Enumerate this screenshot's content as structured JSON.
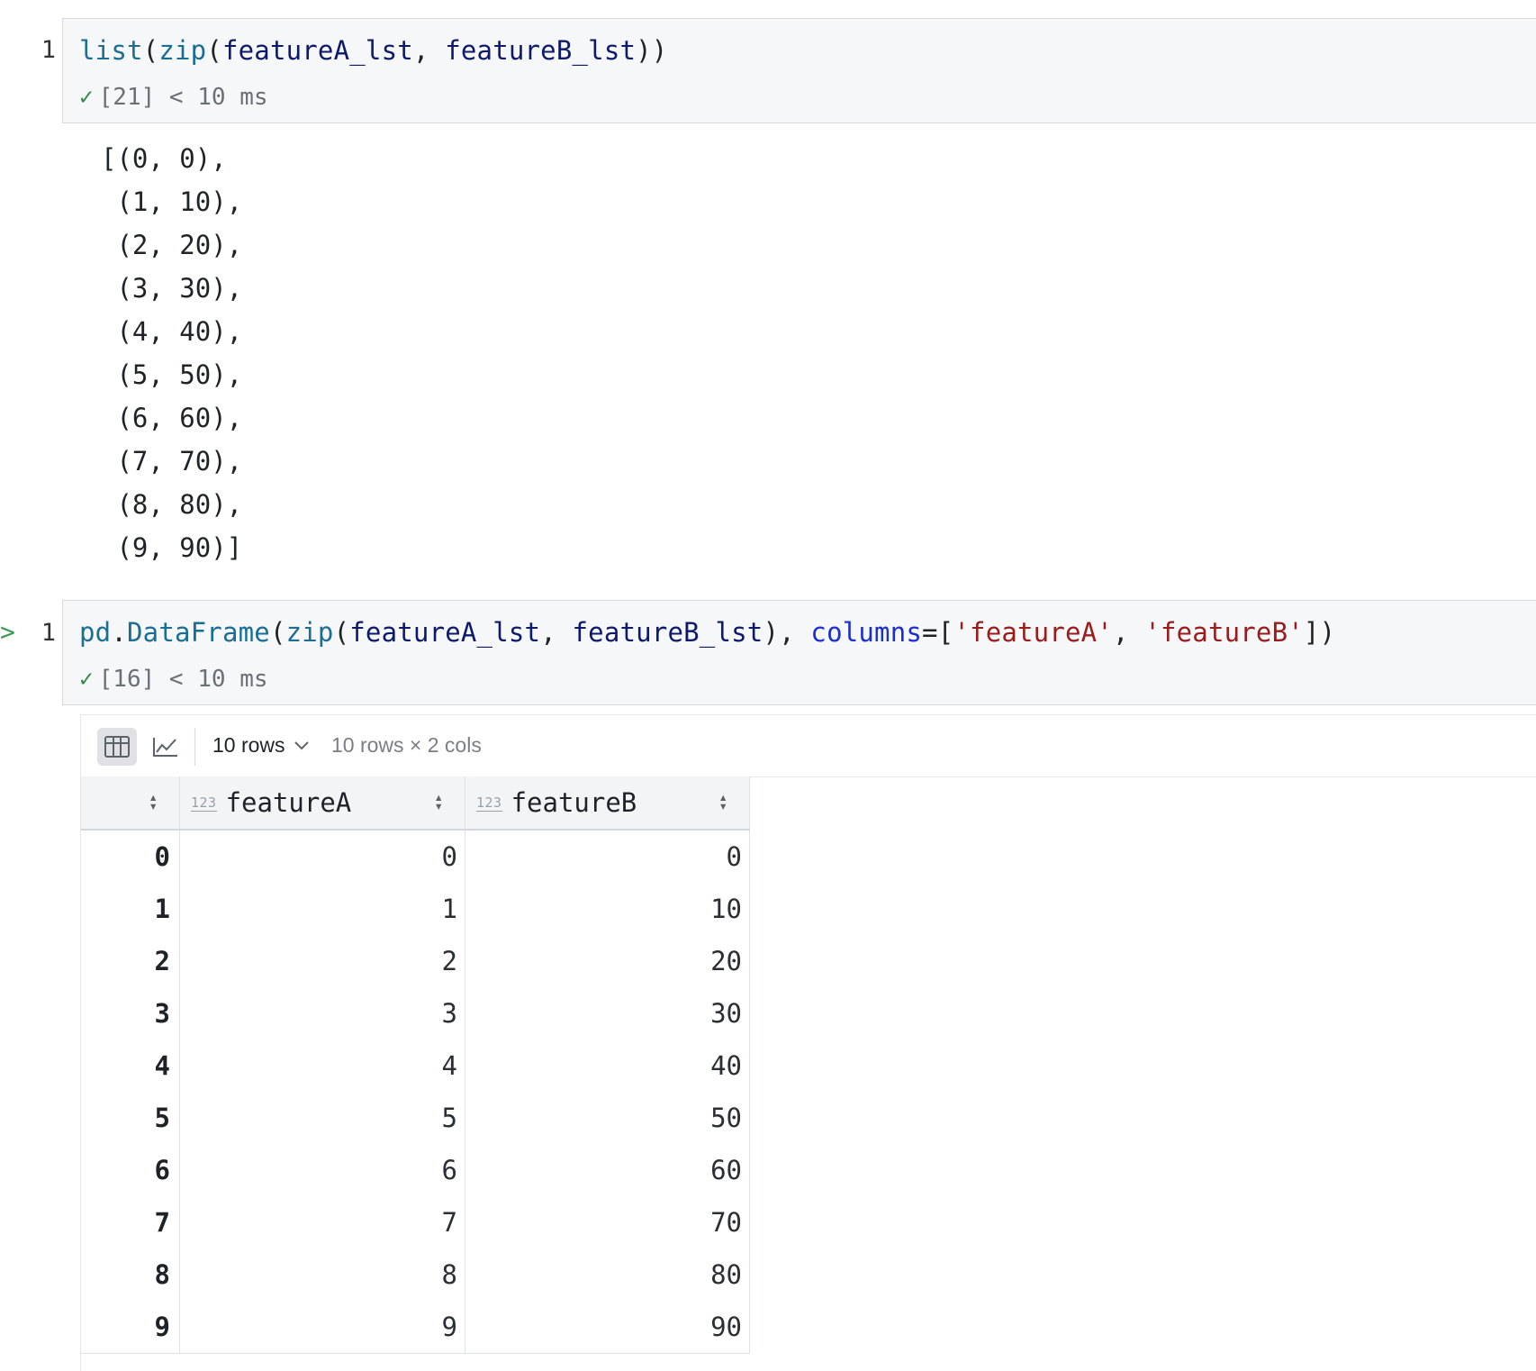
{
  "cell1": {
    "line_number": "1",
    "code_tokens": [
      {
        "t": "list",
        "c": "fn"
      },
      {
        "t": "(",
        "c": "punc"
      },
      {
        "t": "zip",
        "c": "fn"
      },
      {
        "t": "(",
        "c": "punc"
      },
      {
        "t": "featureA_lst",
        "c": "var"
      },
      {
        "t": ", ",
        "c": "punc"
      },
      {
        "t": "featureB_lst",
        "c": "var"
      },
      {
        "t": "))",
        "c": "punc"
      }
    ],
    "status": "[21] < 10 ms"
  },
  "output_list": "[(0, 0),\n (1, 10),\n (2, 20),\n (3, 30),\n (4, 40),\n (5, 50),\n (6, 60),\n (7, 70),\n (8, 80),\n (9, 90)]",
  "cell2": {
    "line_number": "1",
    "run_marker": ">",
    "code_tokens": [
      {
        "t": "pd",
        "c": "fn"
      },
      {
        "t": ".",
        "c": "punc"
      },
      {
        "t": "DataFrame",
        "c": "fn"
      },
      {
        "t": "(",
        "c": "punc"
      },
      {
        "t": "zip",
        "c": "fn"
      },
      {
        "t": "(",
        "c": "punc"
      },
      {
        "t": "featureA_lst",
        "c": "var"
      },
      {
        "t": ", ",
        "c": "punc"
      },
      {
        "t": "featureB_lst",
        "c": "var"
      },
      {
        "t": "), ",
        "c": "punc"
      },
      {
        "t": "columns",
        "c": "kw"
      },
      {
        "t": "=[",
        "c": "punc"
      },
      {
        "t": "'featureA'",
        "c": "str"
      },
      {
        "t": ", ",
        "c": "punc"
      },
      {
        "t": "'featureB'",
        "c": "str"
      },
      {
        "t": "])",
        "c": "punc"
      }
    ],
    "status": "[16] < 10 ms"
  },
  "dataframe": {
    "rows_select": "10 rows",
    "rows_info": "10 rows × 2 cols",
    "type_badge": "123",
    "columns": [
      "featureA",
      "featureB"
    ],
    "index": [
      "0",
      "1",
      "2",
      "3",
      "4",
      "5",
      "6",
      "7",
      "8",
      "9"
    ],
    "rows": [
      [
        "0",
        "0"
      ],
      [
        "1",
        "10"
      ],
      [
        "2",
        "20"
      ],
      [
        "3",
        "30"
      ],
      [
        "4",
        "40"
      ],
      [
        "5",
        "50"
      ],
      [
        "6",
        "60"
      ],
      [
        "7",
        "70"
      ],
      [
        "8",
        "80"
      ],
      [
        "9",
        "90"
      ]
    ]
  },
  "icons": {
    "check": "checkmark-icon",
    "table_view": "table-icon",
    "chart_view": "line-chart-icon",
    "chevron": "chevron-down-icon",
    "sort": "sort-icon"
  },
  "colors": {
    "success": "#2e8b45",
    "function": "#1a6e93",
    "variable": "#0d1a6b",
    "keyword": "#1a2fd0",
    "string": "#9b1c1c"
  }
}
